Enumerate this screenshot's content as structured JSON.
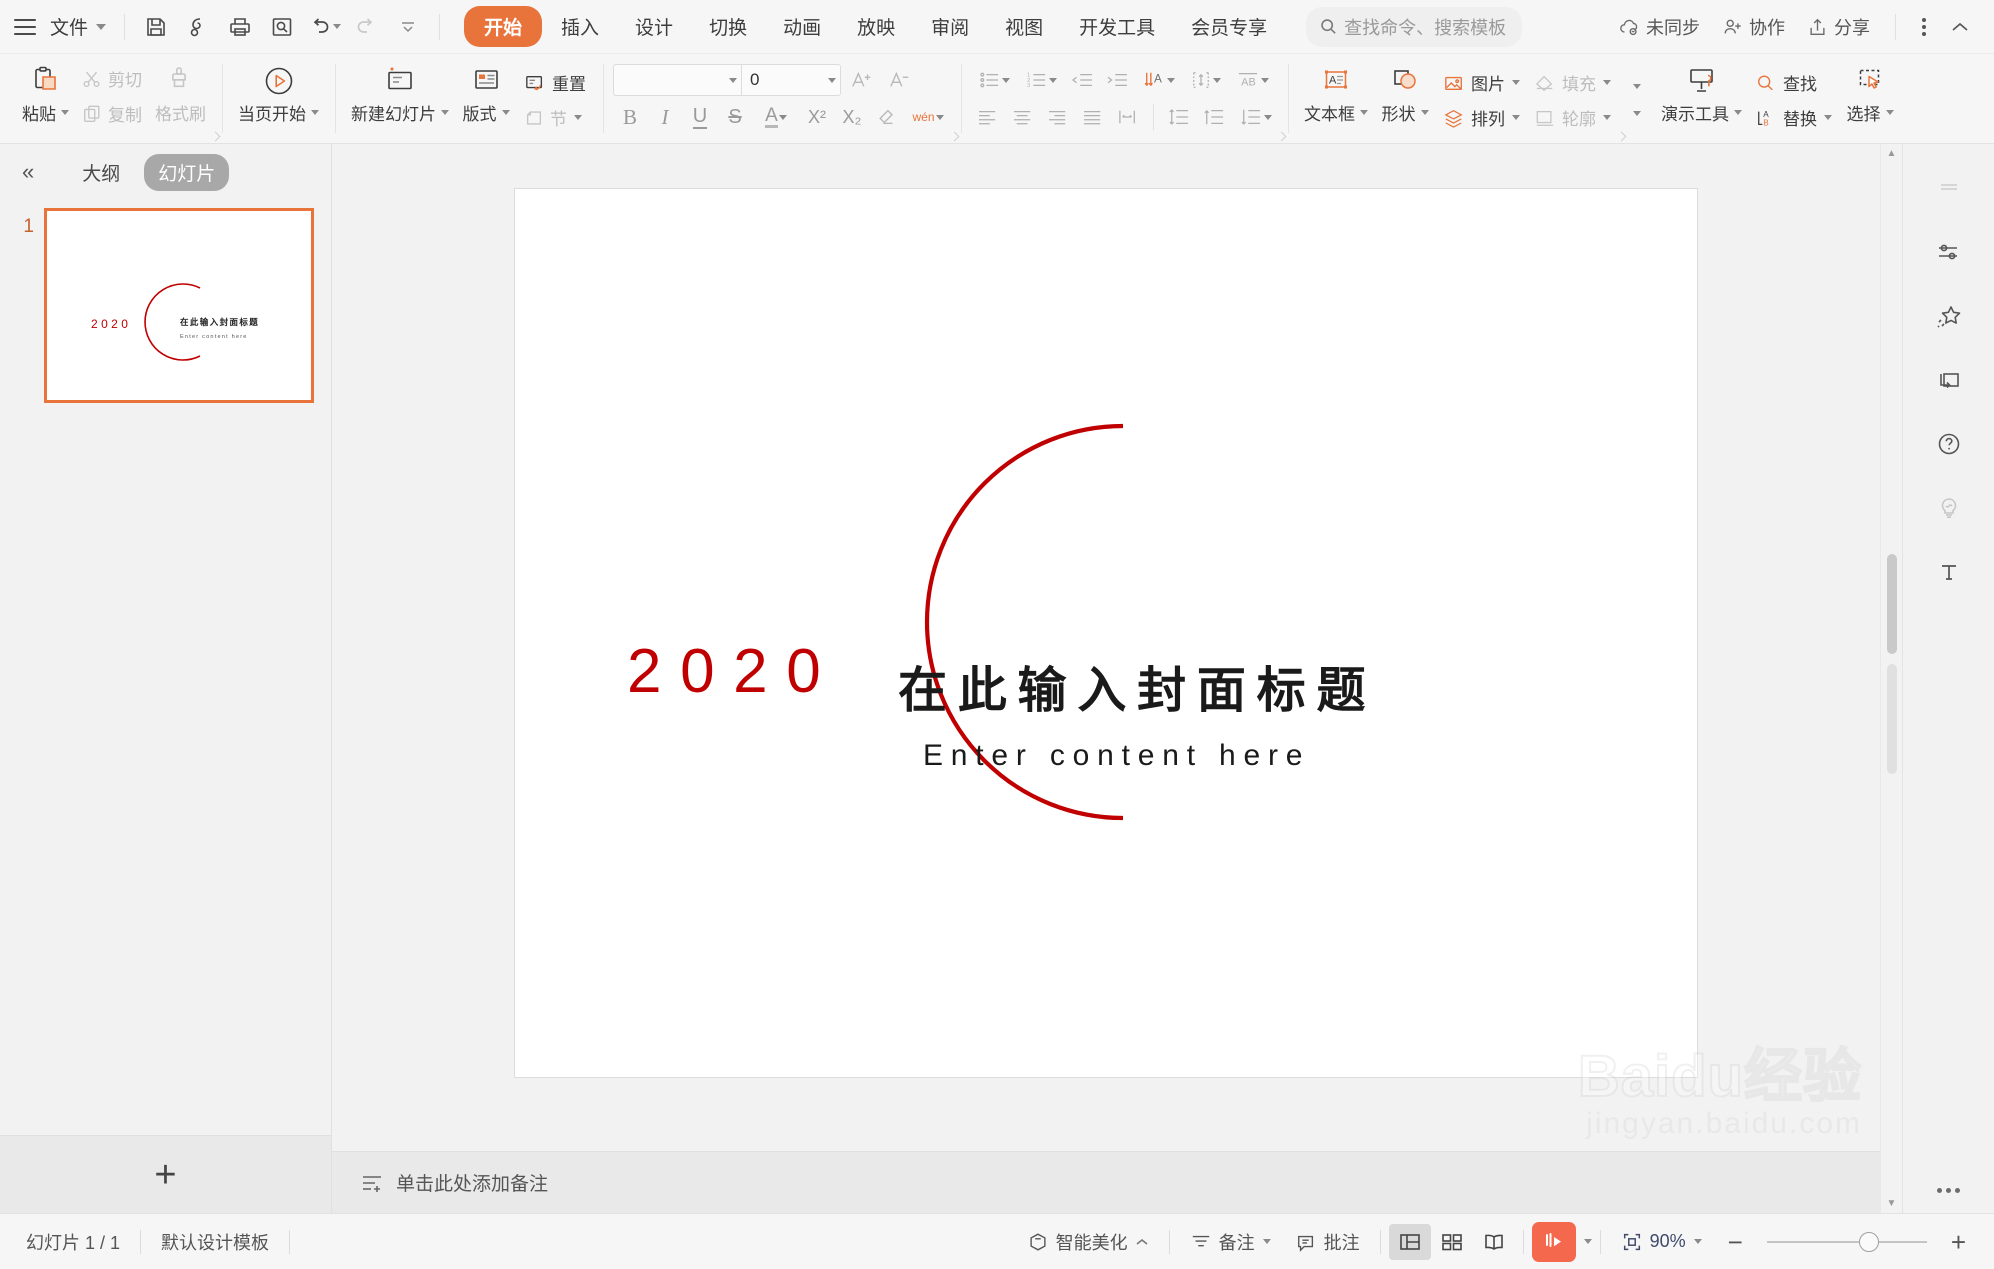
{
  "titlebar": {
    "file_label": "文件",
    "quick_access": [
      {
        "name": "save-icon",
        "tooltip": "保存"
      },
      {
        "name": "save-as-icon",
        "tooltip": "另存为"
      },
      {
        "name": "print-icon",
        "tooltip": "打印"
      },
      {
        "name": "print-preview-icon",
        "tooltip": "打印预览"
      },
      {
        "name": "undo-icon",
        "tooltip": "撤销"
      },
      {
        "name": "redo-icon",
        "tooltip": "恢复"
      },
      {
        "name": "customize-qat-icon",
        "tooltip": "自定义快速访问工具栏"
      }
    ],
    "tabs": [
      {
        "label": "开始",
        "active": true
      },
      {
        "label": "插入",
        "active": false
      },
      {
        "label": "设计",
        "active": false
      },
      {
        "label": "切换",
        "active": false
      },
      {
        "label": "动画",
        "active": false
      },
      {
        "label": "放映",
        "active": false
      },
      {
        "label": "审阅",
        "active": false
      },
      {
        "label": "视图",
        "active": false
      },
      {
        "label": "开发工具",
        "active": false
      },
      {
        "label": "会员专享",
        "active": false
      }
    ],
    "search_placeholder": "查找命令、搜索模板",
    "right_items": [
      {
        "label": "未同步",
        "icon": "cloud-sync-icon"
      },
      {
        "label": "协作",
        "icon": "collaborate-user-icon"
      },
      {
        "label": "分享",
        "icon": "share-icon"
      }
    ],
    "more_icon": "more-vertical-icon",
    "collapse_ribbon_icon": "chevron-up-icon"
  },
  "ribbon": {
    "clipboard": {
      "paste": "粘贴",
      "cut": "剪切",
      "copy": "复制",
      "format_painter": "格式刷"
    },
    "start_from_page": "当页开始",
    "slides": {
      "new_slide": "新建幻灯片",
      "layout": "版式",
      "reset": "重置",
      "section": "节"
    },
    "font": {
      "font_name_value": "",
      "font_size_value": "0",
      "grow_font": "A+",
      "shrink_font": "A-",
      "bold": "B",
      "italic": "I",
      "underline": "U",
      "strikethrough": "S",
      "font_color": "A",
      "superscript": "X²",
      "subscript": "X₂",
      "clear_format": "清除格式",
      "pinyin": "wén"
    },
    "paragraph": {
      "bullets": "项目符号",
      "numbering": "编号",
      "decrease_indent": "减少缩进",
      "increase_indent": "增加缩进",
      "text_direction": "文字方向",
      "align_text": "对齐文本",
      "columns": "分栏",
      "align_left": "左对齐",
      "align_center": "居中",
      "align_right": "右对齐",
      "justify": "两端对齐",
      "distribute": "分散对齐",
      "line_spacing": "行距",
      "space_before": "段前距",
      "space_after": "段后距"
    },
    "insert": {
      "textbox": "文本框",
      "shape": "形状",
      "picture": "图片",
      "arrange": "排列",
      "fill": "填充",
      "outline": "轮廓"
    },
    "tools": {
      "present_tools": "演示工具",
      "find": "查找",
      "replace": "替换",
      "select": "选择"
    }
  },
  "slide_panel": {
    "collapse_icon": "chevron-double-left-icon",
    "tabs": [
      {
        "label": "大纲",
        "active": false
      },
      {
        "label": "幻灯片",
        "active": true
      }
    ],
    "thumbnails": [
      {
        "number": "1",
        "selected": true
      }
    ],
    "add_slide_icon": "plus-icon"
  },
  "slide": {
    "year": "2020",
    "title": "在此输入封面标题",
    "subtitle": "Enter content here",
    "accent_color": "#c00000",
    "title_color": "#1a1a1a",
    "background": "#ffffff"
  },
  "notes": {
    "placeholder": "单击此处添加备注",
    "icon": "notes-icon"
  },
  "right_rail": {
    "items": [
      {
        "name": "panel-toggle-icon",
        "dim": true
      },
      {
        "name": "properties-sliders-icon",
        "dim": false
      },
      {
        "name": "beautify-star-icon",
        "dim": false
      },
      {
        "name": "shape-replace-icon",
        "dim": false
      },
      {
        "name": "help-circle-icon",
        "dim": false
      },
      {
        "name": "lightbulb-idea-icon",
        "dim": true
      },
      {
        "name": "text-tool-icon",
        "dim": false
      }
    ],
    "more_icon": "more-horizontal-icon"
  },
  "statusbar": {
    "slide_count": "幻灯片 1 / 1",
    "template": "默认设计模板",
    "smart_beautify": "智能美化",
    "notes": "备注",
    "comments": "批注",
    "views": [
      {
        "name": "normal-view",
        "active": true
      },
      {
        "name": "slide-sorter-view",
        "active": false
      },
      {
        "name": "reading-view",
        "active": false
      }
    ],
    "play_icon": "play-presentation-icon",
    "fit_icon": "fit-to-window-icon",
    "zoom_level": "90%",
    "zoom_out": "−",
    "zoom_in": "+"
  },
  "watermark": {
    "brand": "Baidu经验",
    "url": "jingyan.baidu.com"
  }
}
